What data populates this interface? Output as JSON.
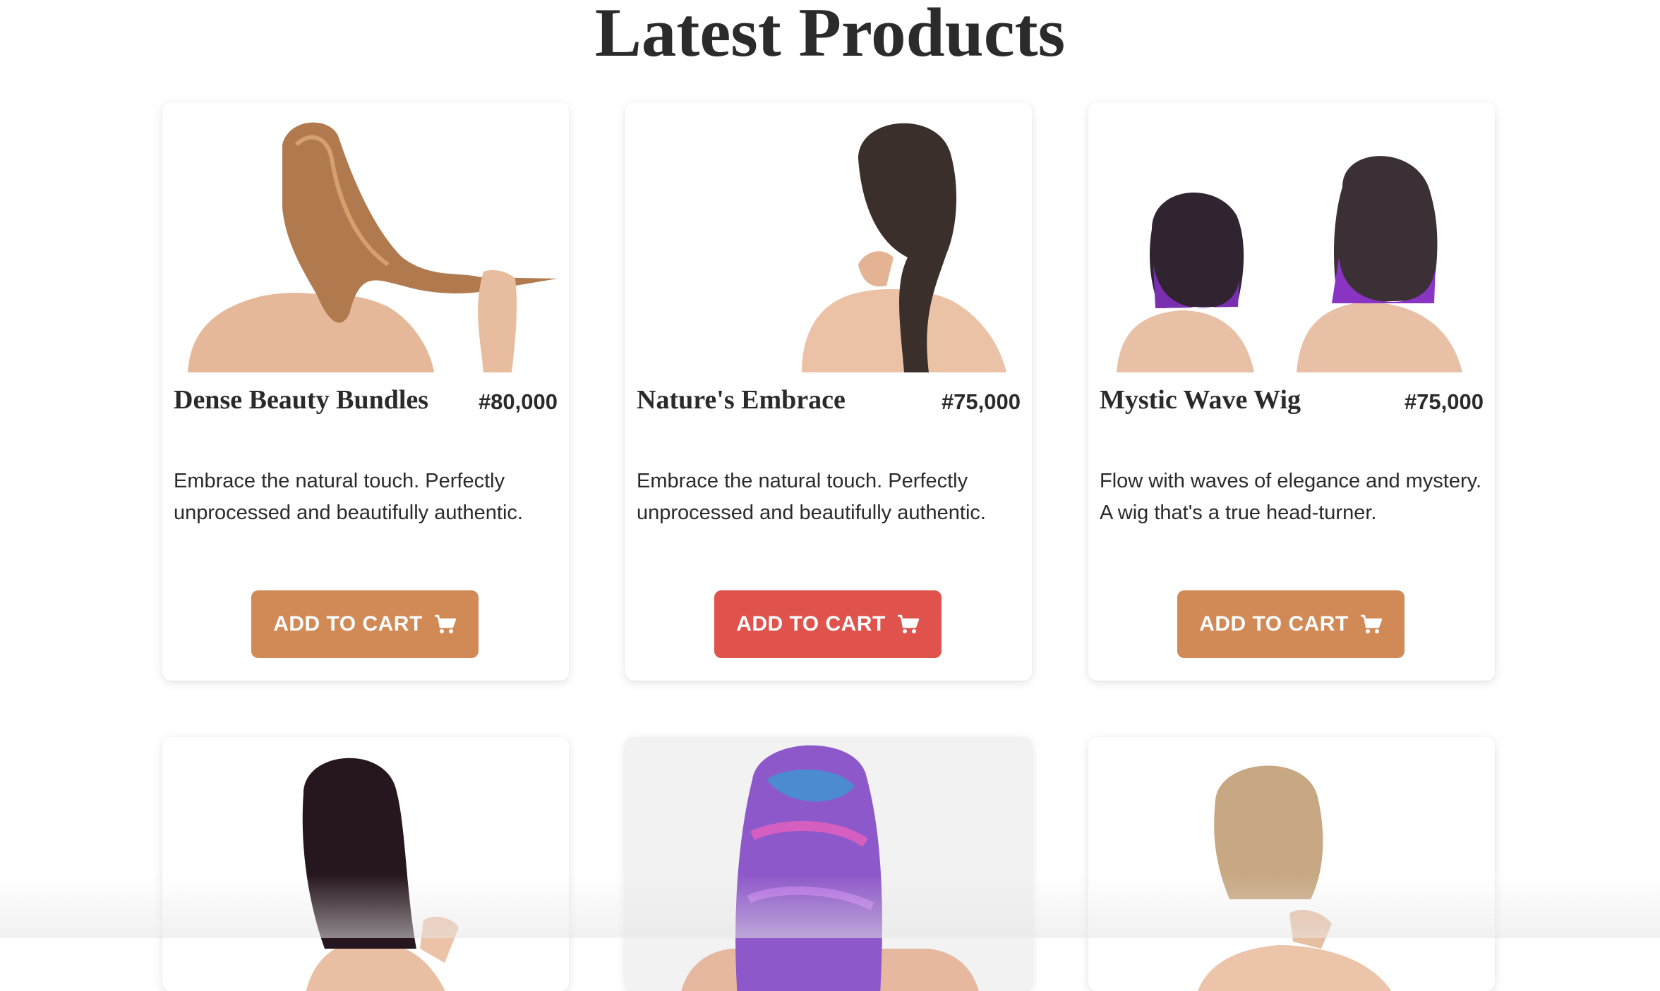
{
  "page": {
    "title": "Latest Products"
  },
  "colors": {
    "button_default": "#d18956",
    "button_active": "#e0524c",
    "text": "#2a2a2a"
  },
  "products": [
    {
      "name": "Dense Beauty Bundles",
      "price": "#80,000",
      "description": "Embrace the natural touch. Perfectly unprocessed and beautifully authentic.",
      "button_label": "ADD TO CART",
      "image": "straight-light-brown-hair-photo"
    },
    {
      "name": "Nature's Embrace",
      "price": "#75,000",
      "description": "Embrace the natural touch. Perfectly unprocessed and beautifully authentic.",
      "button_label": "ADD TO CART",
      "image": "dark-ponytail-hair-photo"
    },
    {
      "name": "Mystic Wave Wig",
      "price": "#75,000",
      "description": "Flow with waves of elegance and mystery. A wig that's a true head-turner.",
      "button_label": "ADD TO CART",
      "image": "purple-ombre-bob-wig-photo"
    },
    {
      "image": "long-dark-straight-hair-photo"
    },
    {
      "image": "rainbow-wavy-hair-photo"
    },
    {
      "image": "blonde-short-bob-photo"
    }
  ]
}
